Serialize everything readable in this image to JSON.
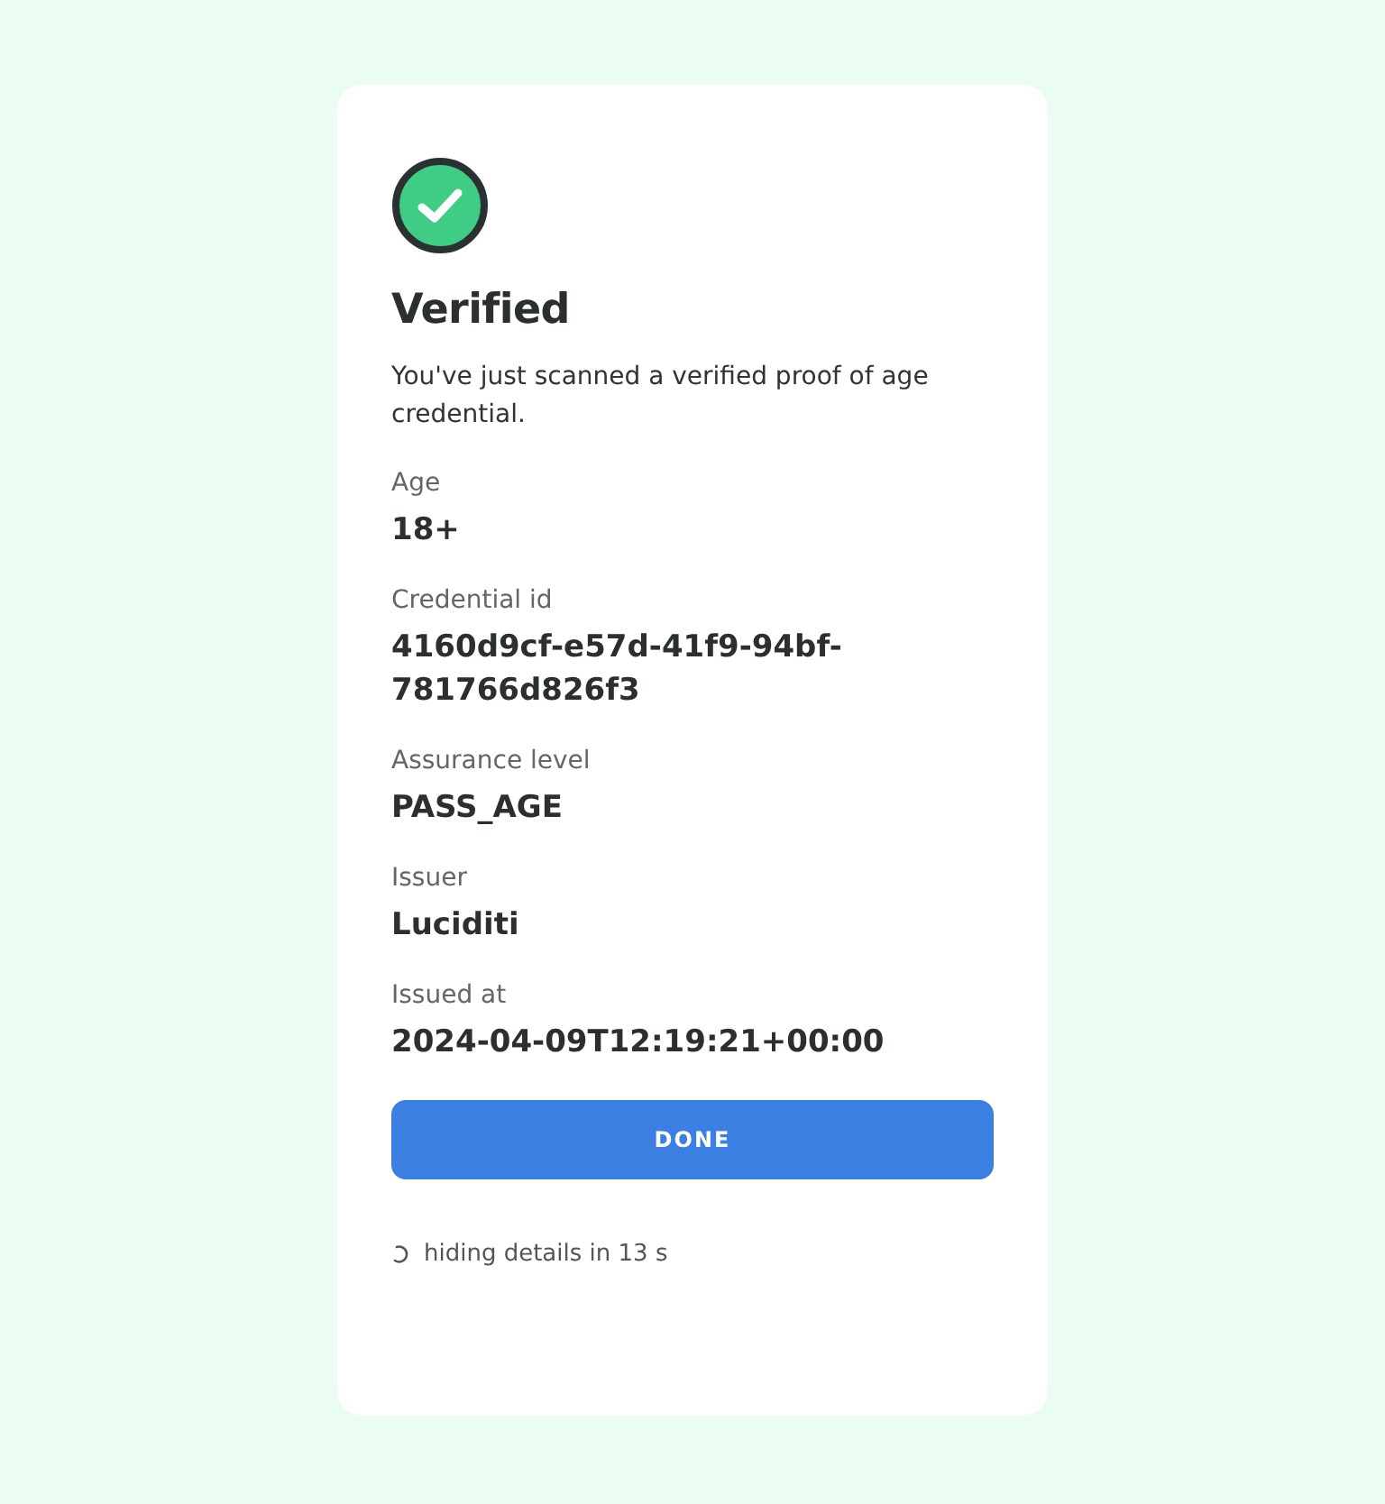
{
  "status": {
    "title": "Verified",
    "message": "You've just scanned a verified proof of age credential."
  },
  "fields": [
    {
      "label": "Age",
      "value": "18+"
    },
    {
      "label": "Credential id",
      "value": "4160d9cf-e57d-41f9-94bf-781766d826f3"
    },
    {
      "label": "Assurance level",
      "value": "PASS_AGE"
    },
    {
      "label": "Issuer",
      "value": "Luciditi"
    },
    {
      "label": "Issued at",
      "value": "2024-04-09T12:19:21+00:00"
    }
  ],
  "button": {
    "label": "DONE"
  },
  "countdown": {
    "text": "hiding details in 13 s"
  }
}
